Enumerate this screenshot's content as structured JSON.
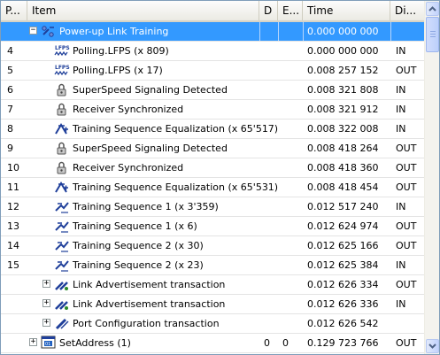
{
  "columns": {
    "packet": "P...",
    "item": "Item",
    "d": "D",
    "e": "E...",
    "time": "Time",
    "dir": "Di..."
  },
  "rows": [
    {
      "num": "",
      "label": "Power-up Link Training",
      "time": "0.000 000 000",
      "dir": "",
      "d": "",
      "e": "",
      "icon": "link-training-icon",
      "toggle": "−",
      "level": 1,
      "selected": true
    },
    {
      "num": "4",
      "label": "Polling.LFPS (x 809)",
      "time": "0.000 000 000",
      "dir": "IN",
      "d": "",
      "e": "",
      "icon": "lfps-icon",
      "toggle": "",
      "level": 2
    },
    {
      "num": "5",
      "label": "Polling.LFPS (x 17)",
      "time": "0.008 257 152",
      "dir": "OUT",
      "d": "",
      "e": "",
      "icon": "lfps-icon",
      "toggle": "",
      "level": 2
    },
    {
      "num": "6",
      "label": "SuperSpeed Signaling Detected",
      "time": "0.008 321 808",
      "dir": "IN",
      "d": "",
      "e": "",
      "icon": "signal-detect-icon",
      "toggle": "",
      "level": 2
    },
    {
      "num": "7",
      "label": "Receiver Synchronized",
      "time": "0.008 321 912",
      "dir": "IN",
      "d": "",
      "e": "",
      "icon": "signal-detect-icon",
      "toggle": "",
      "level": 2
    },
    {
      "num": "8",
      "label": "Training Sequence Equalization (x 65'517)",
      "time": "0.008 322 008",
      "dir": "IN",
      "d": "",
      "e": "",
      "icon": "equalization-icon",
      "toggle": "",
      "level": 2
    },
    {
      "num": "9",
      "label": "SuperSpeed Signaling Detected",
      "time": "0.008 418 264",
      "dir": "OUT",
      "d": "",
      "e": "",
      "icon": "signal-detect-icon",
      "toggle": "",
      "level": 2
    },
    {
      "num": "10",
      "label": "Receiver Synchronized",
      "time": "0.008 418 360",
      "dir": "OUT",
      "d": "",
      "e": "",
      "icon": "signal-detect-icon",
      "toggle": "",
      "level": 2
    },
    {
      "num": "11",
      "label": "Training Sequence Equalization (x 65'531)",
      "time": "0.008 418 454",
      "dir": "OUT",
      "d": "",
      "e": "",
      "icon": "equalization-icon",
      "toggle": "",
      "level": 2
    },
    {
      "num": "12",
      "label": "Training Sequence 1 (x 3'359)",
      "time": "0.012 517 240",
      "dir": "IN",
      "d": "",
      "e": "",
      "icon": "training-sequence-icon",
      "toggle": "",
      "level": 2
    },
    {
      "num": "13",
      "label": "Training Sequence 1 (x 6)",
      "time": "0.012 624 974",
      "dir": "OUT",
      "d": "",
      "e": "",
      "icon": "training-sequence-icon",
      "toggle": "",
      "level": 2
    },
    {
      "num": "14",
      "label": "Training Sequence 2 (x 30)",
      "time": "0.012 625 166",
      "dir": "OUT",
      "d": "",
      "e": "",
      "icon": "training-sequence-icon",
      "toggle": "",
      "level": 2
    },
    {
      "num": "15",
      "label": "Training Sequence 2 (x 23)",
      "time": "0.012 625 384",
      "dir": "IN",
      "d": "",
      "e": "",
      "icon": "training-sequence-icon",
      "toggle": "",
      "level": 2
    },
    {
      "num": "",
      "label": "Link Advertisement transaction",
      "time": "0.012 626 334",
      "dir": "OUT",
      "d": "",
      "e": "",
      "icon": "transaction-icon",
      "toggle": "+",
      "level": 2
    },
    {
      "num": "",
      "label": "Link Advertisement transaction",
      "time": "0.012 626 336",
      "dir": "IN",
      "d": "",
      "e": "",
      "icon": "transaction-icon",
      "toggle": "+",
      "level": 2
    },
    {
      "num": "",
      "label": "Port Configuration transaction",
      "time": "0.012 626 542",
      "dir": "",
      "d": "",
      "e": "",
      "icon": "port-config-icon",
      "toggle": "+",
      "level": 2
    },
    {
      "num": "",
      "label": "SetAddress (1)",
      "time": "0.129 723 766",
      "dir": "OUT",
      "d": "0",
      "e": "0",
      "icon": "setaddress-icon",
      "toggle": "+",
      "level": 1
    }
  ]
}
